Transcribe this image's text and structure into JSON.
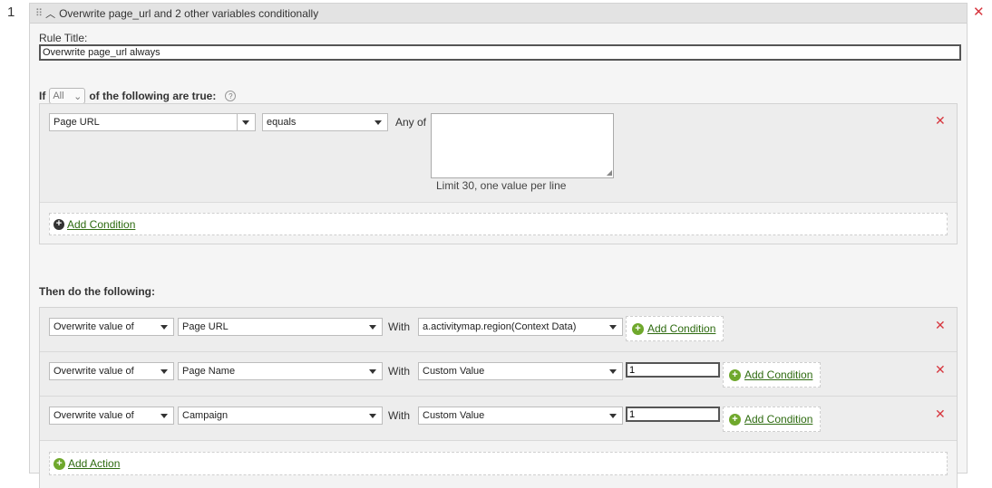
{
  "rule": {
    "number": "1",
    "header_title": "Overwrite page_url and 2 other variables conditionally",
    "title_label": "Rule Title:",
    "title_value": "Overwrite page_url always"
  },
  "conditions": {
    "if_label": "If",
    "match_mode": "All",
    "match_suffix": "of the following are true:",
    "help_glyph": "?",
    "row": {
      "variable": "Page URL",
      "operator": "equals",
      "any_of_label": "Any of",
      "values_text": "",
      "hint": "Limit 30, one value per line"
    },
    "add_condition_label": "Add Condition"
  },
  "actions": {
    "then_label": "Then do the following:",
    "with_label": "With",
    "rows": [
      {
        "operation": "Overwrite value of",
        "variable": "Page URL",
        "value_source": "a.activitymap.region(Context Data)",
        "custom_value": "",
        "add_condition_label": "Add Condition"
      },
      {
        "operation": "Overwrite value of",
        "variable": "Page Name",
        "value_source": "Custom Value",
        "custom_value": "1",
        "add_condition_label": "Add Condition"
      },
      {
        "operation": "Overwrite value of",
        "variable": "Campaign",
        "value_source": "Custom Value",
        "custom_value": "1",
        "add_condition_label": "Add Condition"
      }
    ],
    "add_action_label": "Add Action"
  },
  "icons": {
    "remove": "close-x-icon",
    "collapse": "chevron-up-icon",
    "drag": "drag-handle-icon",
    "add_dark": "plus-circle-dark-icon",
    "add_green": "plus-circle-green-icon"
  },
  "colors": {
    "remove_red": "#d7373f",
    "link_green": "#2d6a0f",
    "add_green": "#6fa82c"
  }
}
